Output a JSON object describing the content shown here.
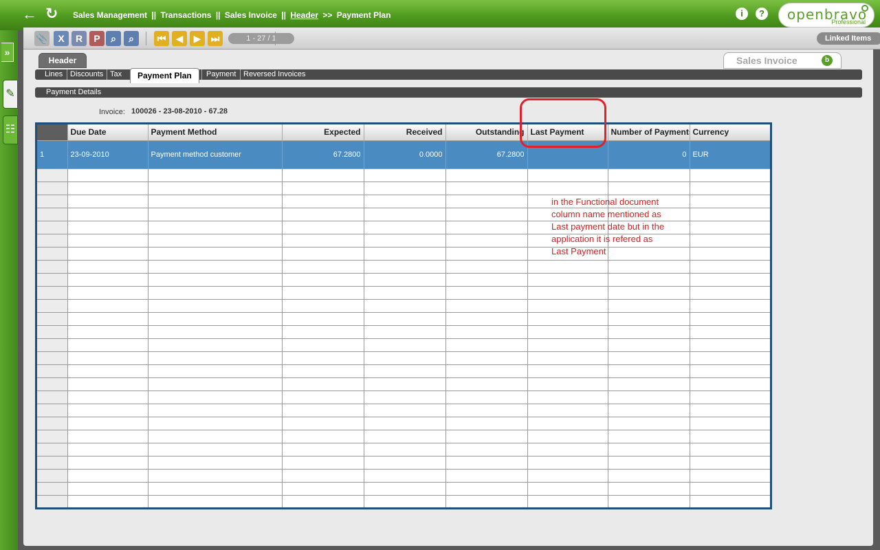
{
  "breadcrumb": {
    "part1": "Sales Management",
    "part2": "Transactions",
    "part3": "Sales Invoice",
    "part4": "Header",
    "part5": "Payment Plan",
    "sep1": "||",
    "sep2": ">>"
  },
  "logo": {
    "brand": "openbravo",
    "edition": "Professional"
  },
  "toolbar": {
    "record_counter": "1 - 27 / 1",
    "linked_items": "Linked Items"
  },
  "header_tab": {
    "label": "Header"
  },
  "window_tab": {
    "label": "Sales Invoice"
  },
  "subtabs": [
    {
      "label": "Lines"
    },
    {
      "label": "Discounts"
    },
    {
      "label": "Tax"
    },
    {
      "label": "Payment Plan"
    },
    {
      "label": "Payment"
    },
    {
      "label": "Reversed Invoices"
    }
  ],
  "details_bar": {
    "label": "Payment Details"
  },
  "invoice": {
    "label": "Invoice:",
    "value": "100026 - 23-08-2010 - 67.28"
  },
  "grid": {
    "columns": [
      "",
      "Due Date",
      "Payment Method",
      "Expected",
      "Received",
      "Outstanding",
      "Last Payment",
      "Number of Payments",
      "Currency"
    ],
    "rows": [
      [
        "1",
        "23-09-2010",
        "Payment method customer",
        "67.2800",
        "0.0000",
        "67.2800",
        "",
        "0",
        "EUR"
      ]
    ]
  },
  "annotation": {
    "line1": "in the Functional document",
    "line2": "column name mentioned as",
    "line3": "Last payment date but in the",
    "line4": "application it is refered as",
    "line5": "Last Payment"
  },
  "colors": {
    "brand_green": "#4e9a1e",
    "selected_row": "#4a8bc2",
    "grid_border": "#1f4e79",
    "annotation_red": "#e0202a"
  }
}
